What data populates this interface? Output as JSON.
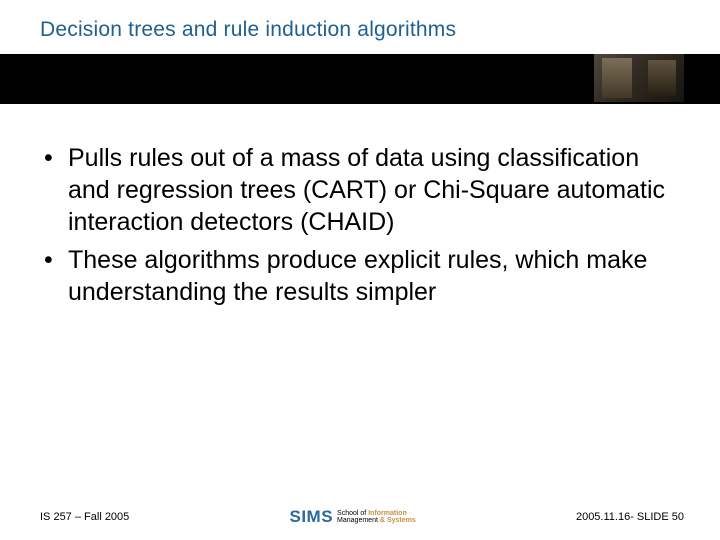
{
  "header": {
    "title": "Decision trees and rule induction algorithms"
  },
  "body": {
    "bullets": [
      "Pulls rules out of a mass of data using classification and regression trees (CART) or Chi-Square automatic interaction detectors (CHAID)",
      "These algorithms produce explicit rules, which make understanding the results simpler"
    ]
  },
  "footer": {
    "left": "IS 257 – Fall 2005",
    "right": "2005.11.16- SLIDE 50",
    "logo": {
      "sims": "SIMS",
      "school_of": "School of",
      "information": "Information",
      "management": "Management",
      "and": "&",
      "systems": "Systems"
    }
  }
}
